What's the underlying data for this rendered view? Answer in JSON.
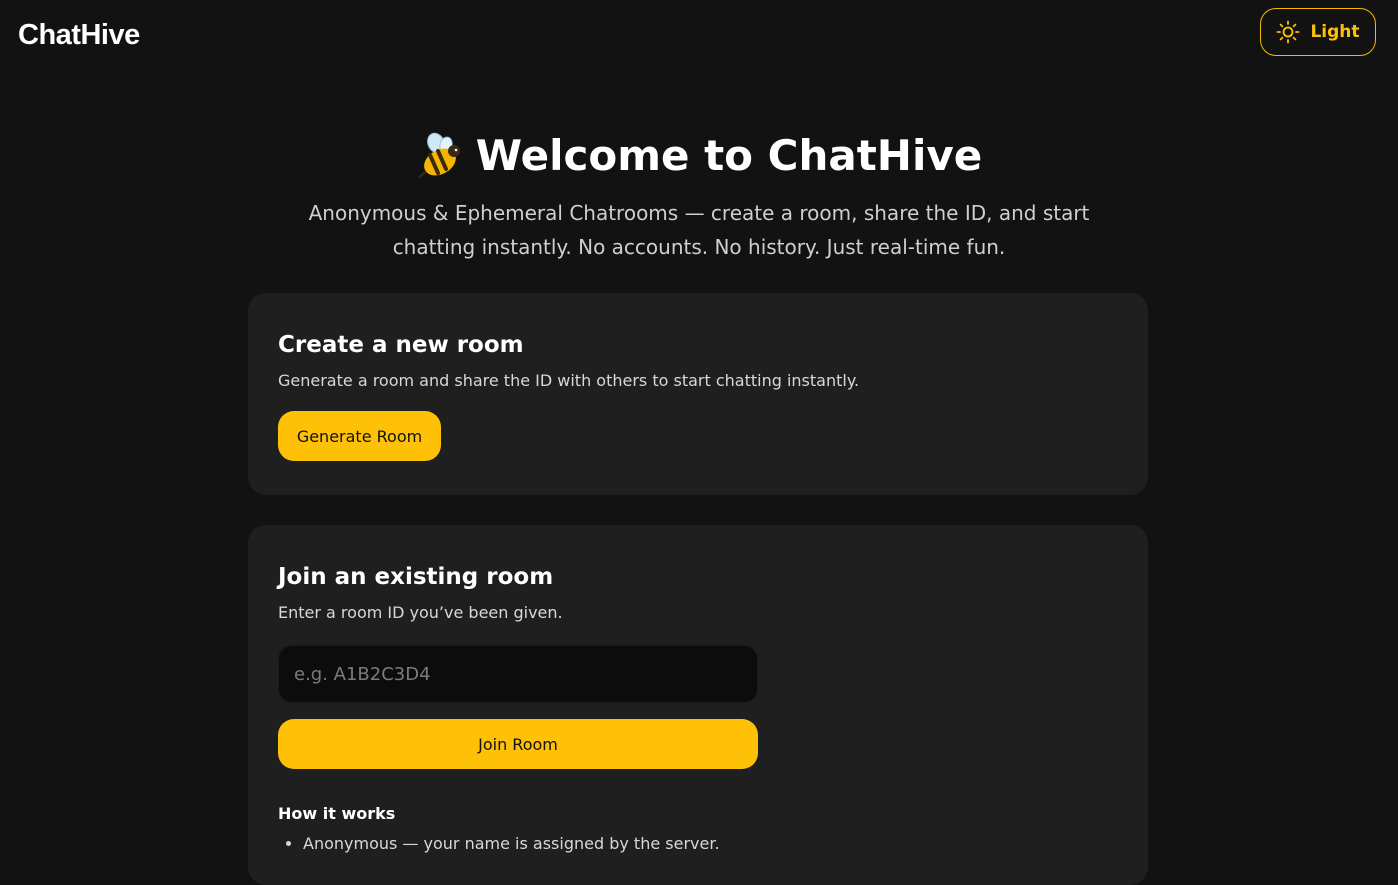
{
  "header": {
    "brand": "ChatHive",
    "theme_toggle_label": "Light",
    "theme_toggle_icon": "sun-icon"
  },
  "hero": {
    "title": "Welcome to ChatHive",
    "title_icon": "bee-icon",
    "subtitle": "Anonymous & Ephemeral Chatrooms — create a room, share the ID, and start chatting instantly. No accounts. No history. Just real-time fun."
  },
  "create_card": {
    "title": "Create a new room",
    "description": "Generate a room and share the ID with others to start chatting instantly.",
    "button_label": "Generate Room"
  },
  "join_card": {
    "title": "Join an existing room",
    "description": "Enter a room ID you’ve been given.",
    "input_placeholder": "e.g. A1B2C3D4",
    "input_value": "",
    "button_label": "Join Room",
    "how_title": "How it works",
    "how_items": [
      "Anonymous — your name is assigned by the server."
    ]
  },
  "colors": {
    "background": "#121212",
    "card": "#1f1f1f",
    "accent": "#ffc107"
  }
}
